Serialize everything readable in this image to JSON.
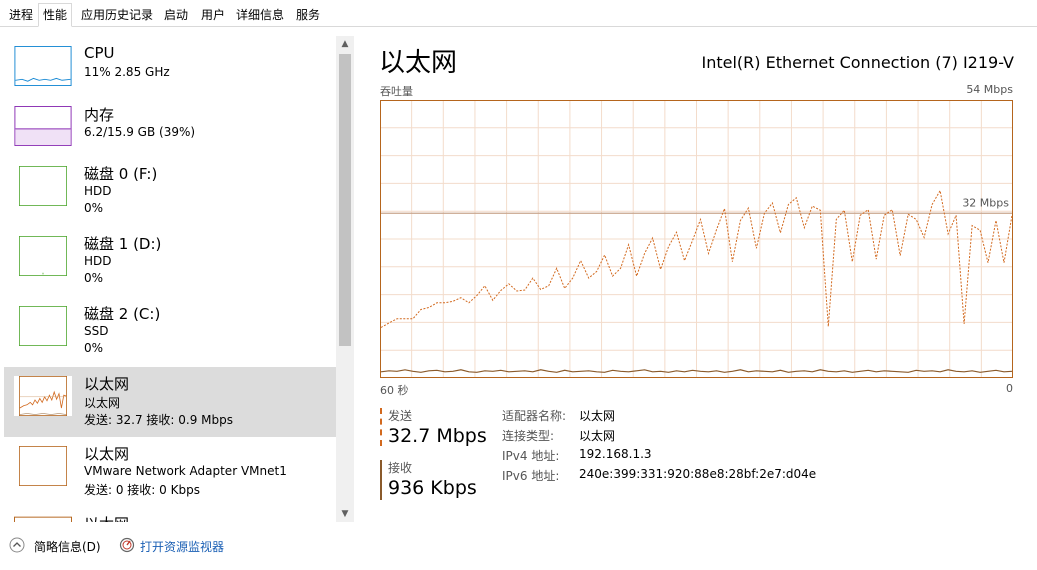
{
  "tabs": [
    "进程",
    "性能",
    "应用历史记录",
    "启动",
    "用户",
    "详细信息",
    "服务"
  ],
  "active_tab": "性能",
  "left_items": [
    {
      "title": "CPU",
      "sub1": "11% 2.85 GHz",
      "sub2": "",
      "color": "#1a8ad4"
    },
    {
      "title": "内存",
      "sub1": "6.2/15.9 GB (39%)",
      "sub2": "",
      "color": "#8b2fb3"
    },
    {
      "title": "磁盘 0 (F:)",
      "sub1": "HDD",
      "sub2": "0%",
      "color": "#4ea72e"
    },
    {
      "title": "磁盘 1 (D:)",
      "sub1": "HDD",
      "sub2": "0%",
      "color": "#4ea72e"
    },
    {
      "title": "磁盘 2 (C:)",
      "sub1": "SSD",
      "sub2": "0%",
      "color": "#4ea72e"
    },
    {
      "title": "以太网",
      "sub1": "以太网",
      "sub2": "发送: 32.7  接收: 0.9 Mbps",
      "color": "#b5651d"
    },
    {
      "title": "以太网",
      "sub1": "VMware Network Adapter VMnet1",
      "sub2": "发送: 0  接收: 0 Kbps",
      "color": "#b5651d"
    },
    {
      "title": "以太网",
      "sub1": "",
      "sub2": "",
      "color": "#b5651d"
    }
  ],
  "main": {
    "title": "以太网",
    "adapter_name": "Intel(R) Ethernet Connection (7) I219-V",
    "throughput_label": "吞吐量",
    "max_label": "54 Mbps",
    "ref_label": "32 Mbps",
    "time_left": "60 秒",
    "time_right": "0",
    "send_label": "发送",
    "send_value": "32.7 Mbps",
    "recv_label": "接收",
    "recv_value": "936 Kbps",
    "info": [
      {
        "k": "适配器名称:",
        "v": "以太网"
      },
      {
        "k": "连接类型:",
        "v": "以太网"
      },
      {
        "k": "IPv4 地址:",
        "v": "192.168.1.3"
      },
      {
        "k": "IPv6 地址:",
        "v": "240e:399:331:920:88e8:28bf:2e7:d04e"
      }
    ]
  },
  "footer": {
    "summary_label": "简略信息(D)",
    "monitor_label": "打开资源监视器"
  },
  "chart_data": {
    "type": "line",
    "x_range": [
      60,
      0
    ],
    "y_range": [
      0,
      54
    ],
    "reference_line": 32,
    "series": [
      {
        "values": [
          9.8,
          10.7,
          11.5,
          11.5,
          11.5,
          13.3,
          13.7,
          14.6,
          14.6,
          14.9,
          15.6,
          14.6,
          16.0,
          17.9,
          15.1,
          17.0,
          18.3,
          16.9,
          17.1,
          19.4,
          17.2,
          17.9,
          21.3,
          17.4,
          19.4,
          22.8,
          19.4,
          20.7,
          23.9,
          19.8,
          21.3,
          25.9,
          19.8,
          24.2,
          27.2,
          21.1,
          25.5,
          28.3,
          22.8,
          26.7,
          30.8,
          24.2,
          28.8,
          32.9,
          22.6,
          30.6,
          33.0,
          25.2,
          32.0,
          34.0,
          28.2,
          33.7,
          35.0,
          29.2,
          33.4,
          32.6,
          10.0,
          30.8,
          32.6,
          22.6,
          31.6,
          32.7,
          23.1,
          31.6,
          32.7,
          23.8,
          31.8,
          30.8,
          27.3,
          33.7,
          36.4,
          28.0,
          31.6,
          10.5,
          29.6,
          28.7,
          22.4,
          30.6,
          22.4,
          31.6
        ]
      },
      {
        "values": [
          1.2,
          1.4,
          1.3,
          1.6,
          1.3,
          1.1,
          1.4,
          1.5,
          1.2,
          1.3,
          1.6,
          1.2,
          1.1,
          1.4,
          1.3,
          1.5,
          1.2,
          1.3,
          1.4,
          1.2,
          1.6,
          1.3,
          1.1,
          1.5,
          1.2,
          1.3,
          1.4,
          1.2,
          1.1,
          1.5,
          1.3,
          1.2,
          1.4,
          1.6,
          1.2,
          1.3,
          1.1,
          1.4,
          1.2,
          1.5,
          1.3,
          1.2,
          1.4,
          1.1,
          1.3,
          1.6,
          1.2,
          1.4,
          1.3,
          1.2,
          1.5,
          1.1,
          1.3,
          1.4,
          1.2,
          1.6,
          1.3,
          1.2,
          1.4,
          1.1,
          1.3,
          1.5,
          1.2,
          1.4,
          1.3,
          1.2,
          1.1,
          1.5,
          1.3,
          1.4,
          1.2,
          1.6,
          1.3,
          1.2,
          1.4,
          1.1,
          1.3,
          1.5,
          1.2,
          1.3
        ]
      }
    ]
  }
}
